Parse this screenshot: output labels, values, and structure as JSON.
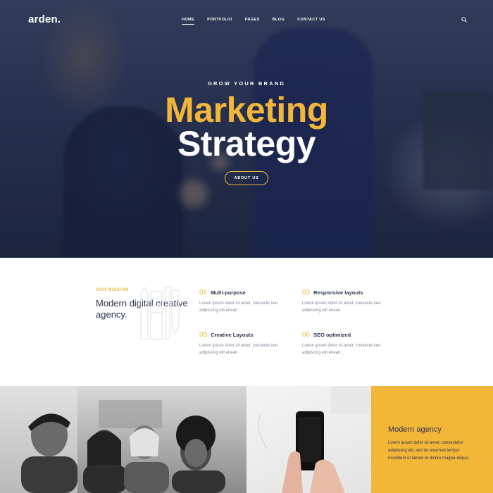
{
  "brand": {
    "logo": "arden."
  },
  "nav": {
    "items": [
      "HOME",
      "PORTFOLIO",
      "PAGES",
      "BLOG",
      "CONTACT US"
    ],
    "active_index": 0
  },
  "hero": {
    "eyebrow": "GROW YOUR BRAND",
    "title_line1": "Marketing",
    "title_line2": "Strategy",
    "button_label": "ABOUT US"
  },
  "mission": {
    "label": "OUR MISSION",
    "title": "Modern digital creative agency."
  },
  "features": [
    {
      "number": "02",
      "title": "Multi-purpose",
      "text": "Lorem ipsum dolor sit amet, consecte tuer adipiscing elit enean."
    },
    {
      "number": "03",
      "title": "Responsive layouts",
      "text": "Lorem ipsum dolor sit amet, consecte tuer adipiscing elit enean."
    },
    {
      "number": "05",
      "title": "Creative Layouts",
      "text": "Lorem ipsum dolor sit amet, consecte tuer adipiscing elit enean."
    },
    {
      "number": "06",
      "title": "SEO optimized",
      "text": "Lorem ipsum dolor sit amet, consecte tuer adipiscing elit enean."
    }
  ],
  "agency": {
    "title": "Modern agency",
    "text": "Lorem ipsum dolor sit amet, consectetur adipiscing elit, sed do eiusmod tempor incididunt ut labore et dolore magna aliqua."
  },
  "colors": {
    "accent": "#f2b638",
    "navy": "#2d3453",
    "muted": "#7e8496"
  },
  "icons": [
    "search-icon"
  ]
}
